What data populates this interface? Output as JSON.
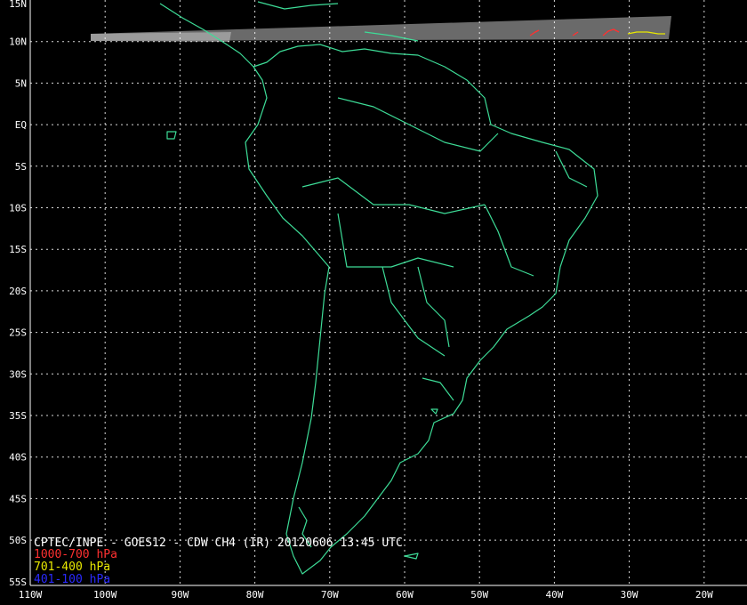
{
  "title": "CPTEC/INPE - GOES12 - CDW CH4 (IR) 20120606 13:45 UTC",
  "lat_labels": [
    "15N",
    "10N",
    "5N",
    "EQ",
    "5S",
    "10S",
    "15S",
    "20S",
    "25S",
    "30S",
    "35S",
    "40S",
    "45S",
    "50S",
    "55S"
  ],
  "lon_labels": [
    "110W",
    "100W",
    "90W",
    "80W",
    "70W",
    "60W",
    "50W",
    "40W",
    "30W",
    "20W"
  ],
  "legend": [
    {
      "label": "1000-700 hPa",
      "color": "#ff3030"
    },
    {
      "label": "701-400 hPa",
      "color": "#e8e800"
    },
    {
      "label": "401-100 hPa",
      "color": "#2a2aff"
    }
  ],
  "colors": {
    "background": "#000000",
    "coastline": "#3ddc97",
    "grid": "#ffffff",
    "satellite_strip": "#8a8a8a"
  },
  "map_extent": {
    "lon": [
      -110,
      -15
    ],
    "lat": [
      -55,
      15
    ]
  }
}
